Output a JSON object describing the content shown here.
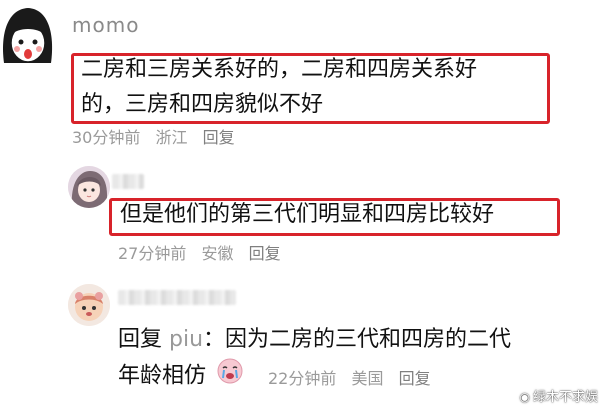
{
  "comments": [
    {
      "username": "momo",
      "text_line1": "二房和三房关系好的，二房和四房关系好",
      "text_line2": "的，三房和四房貌似不好",
      "time": "30分钟前",
      "location": "浙江",
      "reply_label": "回复"
    },
    {
      "text": "但是他们的第三代们明显和四房比较好",
      "time": "27分钟前",
      "location": "安徽",
      "reply_label": "回复"
    },
    {
      "reply_prefix": "回复",
      "reply_to": "piu",
      "text_line1": "：因为二房的三代和四房的二代",
      "text_line2": "年龄相仿",
      "time": "22分钟前",
      "location": "美国",
      "reply_label": "回复"
    }
  ],
  "watermark": "绿木不求娱",
  "colors": {
    "highlight": "#d8232a",
    "meta_text": "#9a9a9a",
    "username": "#8a8a8a"
  }
}
